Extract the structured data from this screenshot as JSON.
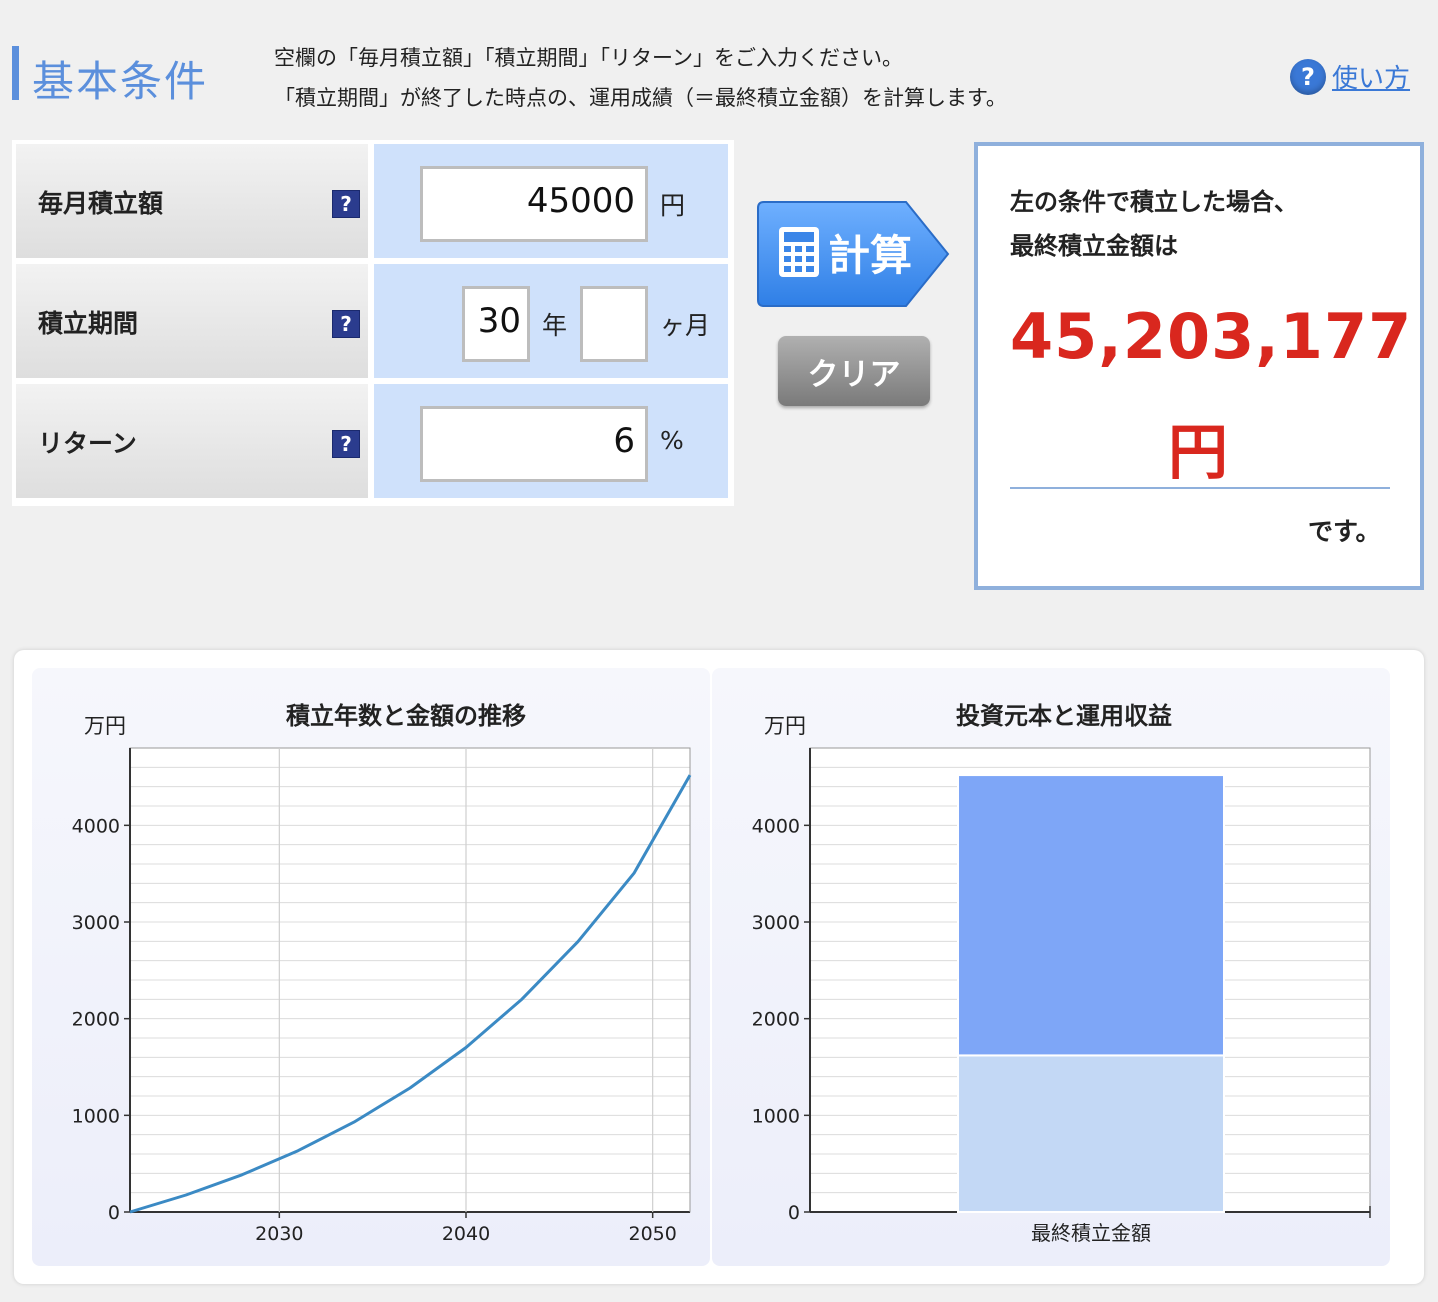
{
  "header": {
    "title": "基本条件",
    "description_line1": "空欄の「毎月積立額」「積立期間」「リターン」をご入力ください。",
    "description_line2": "「積立期間」が終了した時点の、運用成績（＝最終積立金額）を計算します。",
    "help_link_label": "使い方",
    "help_icon": "question-circle-icon"
  },
  "form": {
    "monthly": {
      "label": "毎月積立額",
      "value": "45000",
      "unit": "円"
    },
    "period": {
      "label": "積立期間",
      "years_value": "30",
      "years_unit": "年",
      "months_value": "",
      "months_unit": "ヶ月"
    },
    "return": {
      "label": "リターン",
      "value": "6",
      "unit": "%"
    },
    "help_icon": "question-square-icon"
  },
  "buttons": {
    "calculate": "計算",
    "clear": "クリア"
  },
  "result": {
    "line1": "左の条件で積立した場合、",
    "line2": "最終積立金額は",
    "amount": "45,203,177",
    "yen": "円",
    "suffix": "です。"
  },
  "colors": {
    "accent_blue": "#5b8fdc",
    "result_red": "#d9271e",
    "line_series": "#3b8ac4",
    "bar_principal": "#c3d8f5",
    "bar_return": "#7ea6f7"
  },
  "chart_data": [
    {
      "type": "line",
      "title": "積立年数と金額の推移",
      "ylabel": "万円",
      "xlim": [
        2022,
        2052
      ],
      "ylim": [
        0,
        4800
      ],
      "xticks": [
        "2030",
        "2040",
        "2050"
      ],
      "yticks": [
        "0",
        "1000",
        "2000",
        "3000",
        "4000"
      ],
      "grid": true,
      "x": [
        2022,
        2025,
        2028,
        2031,
        2034,
        2037,
        2040,
        2043,
        2046,
        2049,
        2052
      ],
      "y": [
        0,
        176,
        385,
        634,
        930,
        1283,
        1702,
        2202,
        2797,
        3505,
        4520
      ]
    },
    {
      "type": "bar",
      "stacked": true,
      "title": "投資元本と運用収益",
      "ylabel": "万円",
      "ylim": [
        0,
        4800
      ],
      "yticks": [
        "0",
        "1000",
        "2000",
        "3000",
        "4000"
      ],
      "grid": true,
      "categories": [
        "最終積立金額"
      ],
      "series": [
        {
          "values": [
            1620
          ]
        },
        {
          "values": [
            2900
          ]
        }
      ]
    }
  ]
}
